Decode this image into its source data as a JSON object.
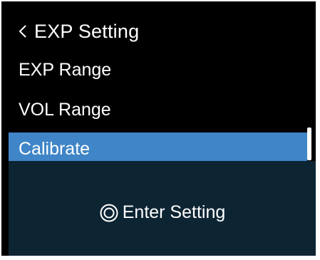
{
  "header": {
    "title": "EXP Setting",
    "back_icon": "chevron-left-icon"
  },
  "menu": {
    "items": [
      {
        "label": "EXP Range",
        "selected": false
      },
      {
        "label": "VOL Range",
        "selected": false
      },
      {
        "label": "Calibrate",
        "selected": true
      }
    ]
  },
  "footer": {
    "hint_icon": "knob-press-icon",
    "hint_label": "Enter Setting"
  },
  "colors": {
    "background": "#000000",
    "selection": "#3f85c7",
    "footer_background": "#0d2433",
    "text": "#ffffff"
  }
}
